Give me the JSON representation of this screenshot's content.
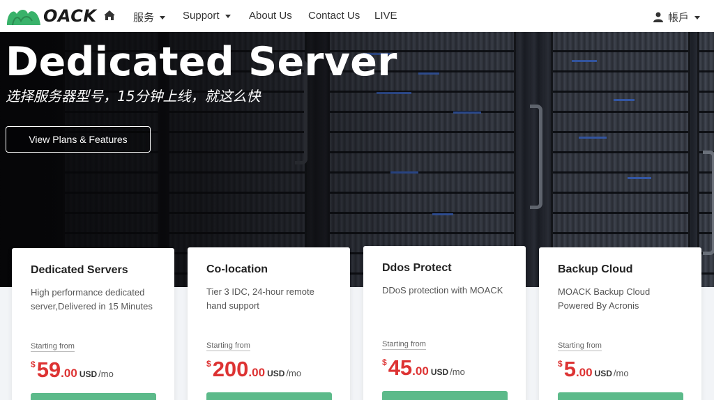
{
  "brand": {
    "logo_text": "OACK",
    "logo_color": "#39b26a"
  },
  "nav": {
    "items": [
      {
        "label": "服务",
        "dropdown": true
      },
      {
        "label": "Support",
        "dropdown": true
      },
      {
        "label": "About Us",
        "dropdown": false
      },
      {
        "label": "Contact Us",
        "dropdown": false
      },
      {
        "label": "LIVE",
        "dropdown": false
      }
    ],
    "account_label": "帳戶"
  },
  "hero": {
    "title": "Dedicated Server",
    "subtitle": "选择服务器型号，15分钟上线，就这么快",
    "button_label": "View Plans & Features"
  },
  "cards": [
    {
      "title": "Dedicated Servers",
      "desc": "High performance dedicated server,Delivered in 15 Minutes",
      "starting": "Starting from",
      "currency": "$",
      "amount": "59",
      "cents": ".00",
      "unit": "USD",
      "period": "/mo"
    },
    {
      "title": "Co-location",
      "desc": "Tier 3 IDC, 24-hour remote hand support",
      "starting": "Starting from",
      "currency": "$",
      "amount": "200",
      "cents": ".00",
      "unit": "USD",
      "period": "/mo"
    },
    {
      "title": "Ddos Protect",
      "desc": "DDoS protection with MOACK",
      "starting": "Starting from",
      "currency": "$",
      "amount": "45",
      "cents": ".00",
      "unit": "USD",
      "period": "/mo"
    },
    {
      "title": "Backup Cloud",
      "desc": "MOACK Backup Cloud Powered By Acronis",
      "starting": "Starting from",
      "currency": "$",
      "amount": "5",
      "cents": ".00",
      "unit": "USD",
      "period": "/mo"
    }
  ],
  "colors": {
    "accent_green": "#5cba8a",
    "price_red": "#d33333"
  }
}
